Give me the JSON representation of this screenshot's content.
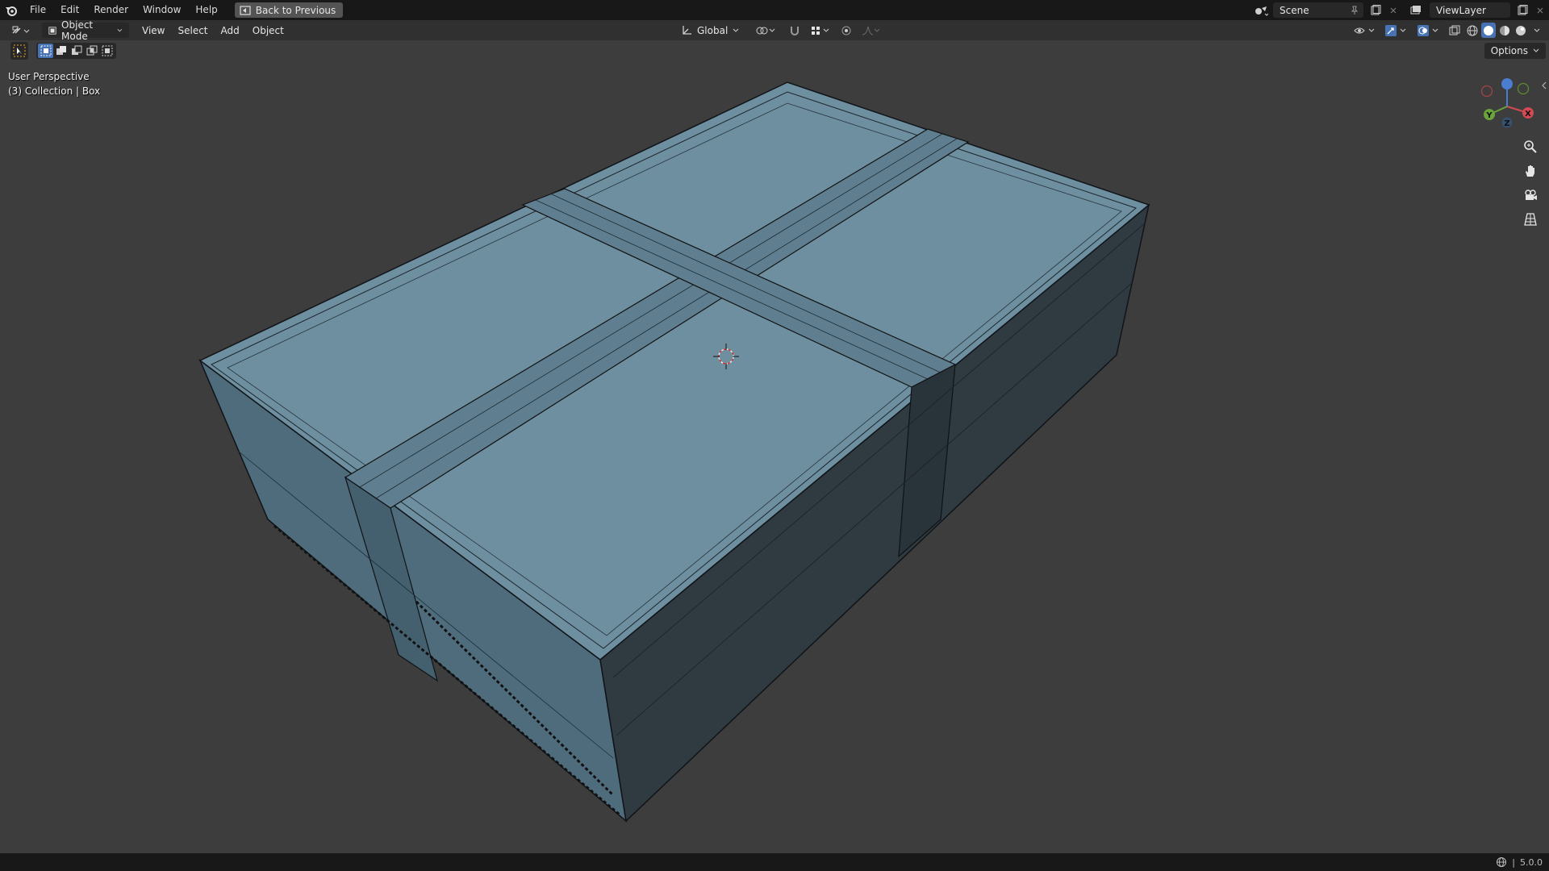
{
  "topbar": {
    "menu": [
      "File",
      "Edit",
      "Render",
      "Window",
      "Help"
    ],
    "back_label": "Back to Previous",
    "scene_name": "Scene",
    "view_layer": "ViewLayer"
  },
  "header": {
    "mode": "Object Mode",
    "menu": [
      "View",
      "Select",
      "Add",
      "Object"
    ],
    "transform_orientation": "Global"
  },
  "toolbar": {
    "options_label": "Options"
  },
  "viewport": {
    "view_name": "User Perspective",
    "collection_info": "(3) Collection | Box"
  },
  "gizmo": {
    "x_label": "X",
    "y_label": "Y",
    "z_label": "Z"
  },
  "status": {
    "separator": "|",
    "version": "5.0.0"
  },
  "colors": {
    "accent": "#4772b3",
    "mesh_top": "#6e8fa0",
    "mesh_side": "#2f3a41",
    "viewport_bg": "#3d3d3d"
  }
}
